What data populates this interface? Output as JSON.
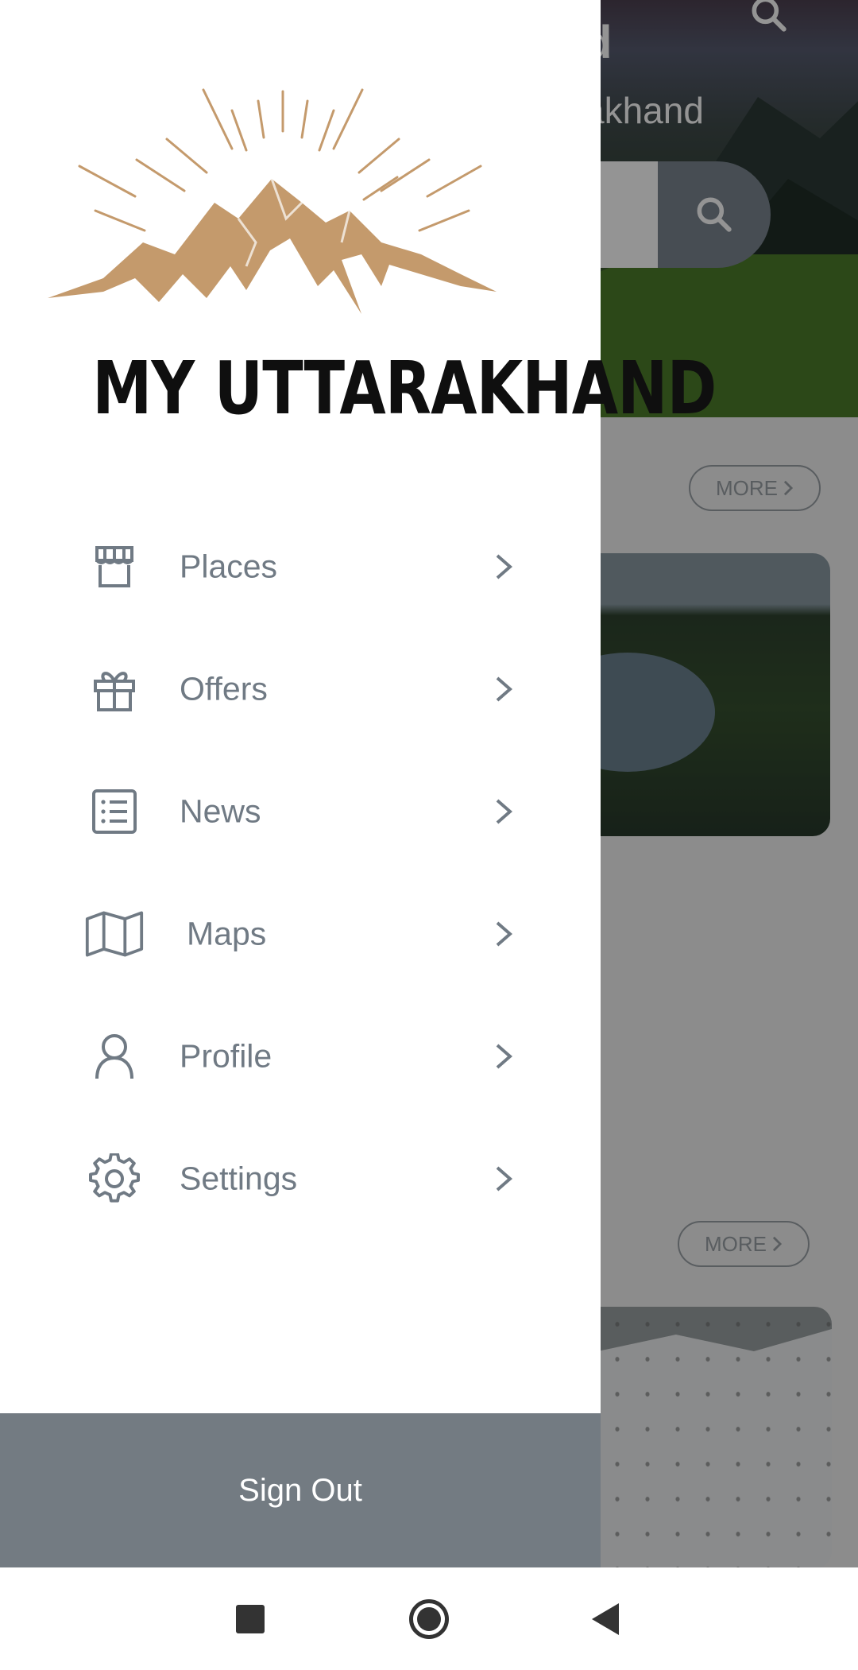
{
  "app": {
    "brand_name": "MY UTTARAKHAND",
    "hero_title": "d",
    "hero_subtitle": "akhand"
  },
  "background_sections": [
    {
      "more_label": "MORE"
    },
    {
      "more_label": "MORE"
    }
  ],
  "drawer": {
    "items": [
      {
        "label": "Places",
        "icon": "store-icon"
      },
      {
        "label": "Offers",
        "icon": "gift-icon"
      },
      {
        "label": "News",
        "icon": "list-icon"
      },
      {
        "label": "Maps",
        "icon": "map-icon"
      },
      {
        "label": "Profile",
        "icon": "person-icon"
      },
      {
        "label": "Settings",
        "icon": "gear-icon"
      }
    ],
    "sign_out_label": "Sign Out"
  },
  "colors": {
    "drawer_text": "#707a84",
    "sign_out_bg": "#737b82",
    "logo_mountain": "#c49a6c",
    "logo_text": "#0f0f0f"
  },
  "navbar": {
    "buttons": [
      "recents-button",
      "home-button",
      "back-button"
    ]
  }
}
